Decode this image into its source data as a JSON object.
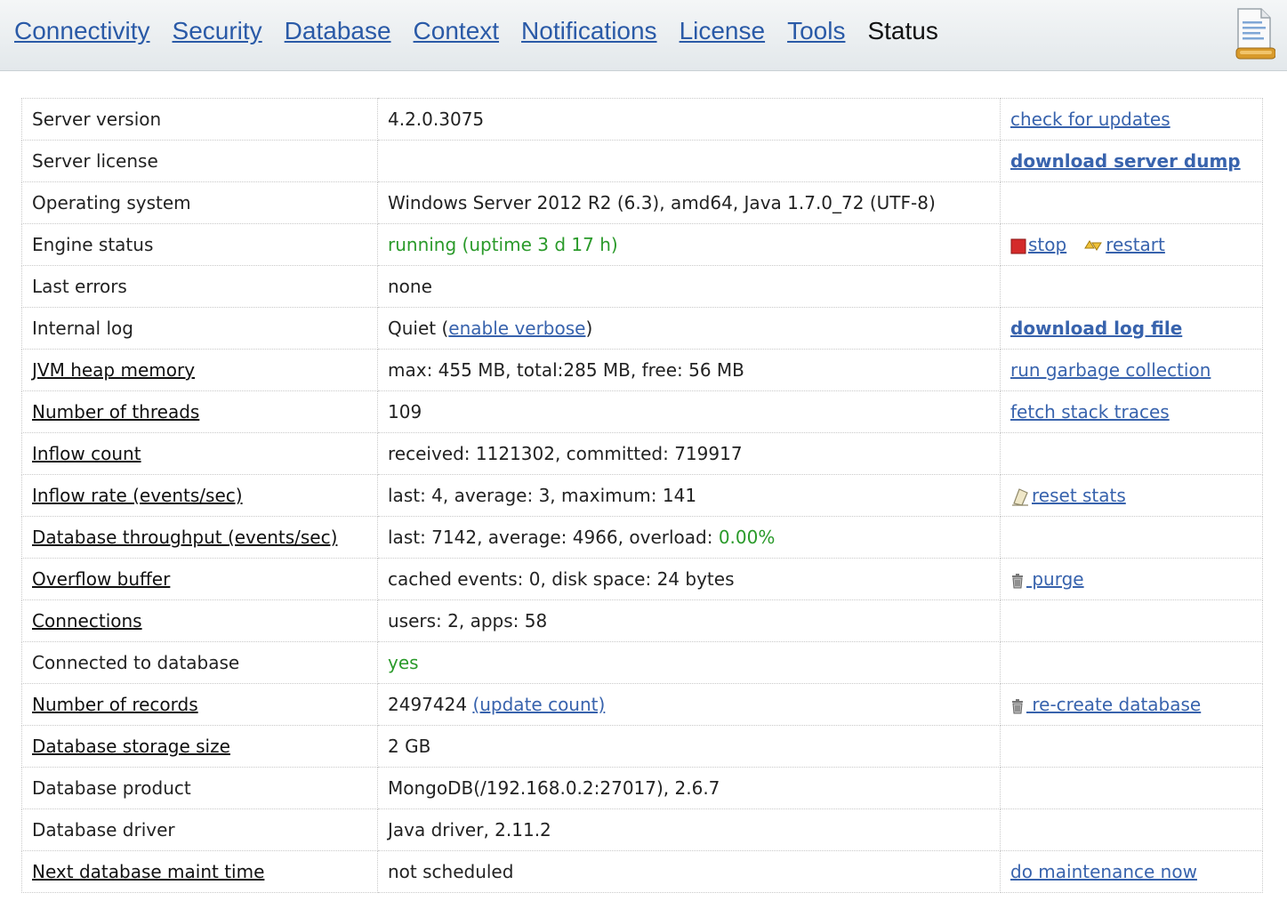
{
  "nav": {
    "tabs": [
      "Connectivity",
      "Security",
      "Database",
      "Context",
      "Notifications",
      "License",
      "Tools",
      "Status"
    ],
    "active": "Status"
  },
  "rows": {
    "server_version": {
      "label": "Server version",
      "value": "4.2.0.3075",
      "action": "check for updates"
    },
    "server_license": {
      "label": "Server license",
      "value": "",
      "action": "download server dump"
    },
    "os": {
      "label": "Operating system",
      "value": "Windows Server 2012 R2 (6.3), amd64, Java 1.7.0_72 (UTF-8)"
    },
    "engine": {
      "label": "Engine status",
      "value": "running (uptime 3 d 17 h)",
      "stop": "stop",
      "restart": "restart"
    },
    "last_errors": {
      "label": "Last errors",
      "value": "none"
    },
    "internal_log": {
      "label": "Internal log",
      "value": "Quiet",
      "open_paren": "(",
      "verbose_link": "enable verbose",
      "close_paren": ")",
      "action": "download log file"
    },
    "jvm_heap": {
      "label": "JVM heap memory",
      "value": "max: 455 MB, total:285 MB, free: 56 MB",
      "action": "run garbage collection"
    },
    "threads": {
      "label": "Number of threads",
      "value": "109",
      "action": "fetch stack traces"
    },
    "inflow_count": {
      "label": "Inflow count",
      "value": "received: 1121302, committed: 719917"
    },
    "inflow_rate": {
      "label": "Inflow rate (events/sec)",
      "value": "last: 4, average: 3, maximum: 141",
      "action": "reset stats"
    },
    "db_throughput": {
      "label": "Database throughput (events/sec)",
      "value": "last: 7142, average: 4966, overload: ",
      "overload": "0.00%"
    },
    "overflow": {
      "label": "Overflow buffer",
      "value": "cached events: 0, disk space: 24 bytes",
      "action": " purge"
    },
    "connections": {
      "label": "Connections",
      "value": "users: 2, apps: 58"
    },
    "connected_db": {
      "label": "Connected to database",
      "value": "yes"
    },
    "records": {
      "label": "Number of records",
      "value": "2497424",
      "link": "(update count)",
      "action": " re-create database"
    },
    "storage": {
      "label": "Database storage size",
      "value": "2 GB"
    },
    "product": {
      "label": "Database product",
      "value": "MongoDB(/192.168.0.2:27017), 2.6.7"
    },
    "driver": {
      "label": "Database driver",
      "value": "Java driver, 2.11.2"
    },
    "maint": {
      "label": "Next database maint time",
      "value": "not scheduled",
      "action": "do maintenance now"
    }
  },
  "icons": {
    "stop": "stop-square-icon",
    "restart": "restart-arrows-icon",
    "reset": "eraser-icon",
    "purge": "trash-icon",
    "recreate": "trash-icon",
    "document": "document-icon"
  },
  "colors": {
    "link": "#3863ad",
    "ok": "#2a9a2a",
    "stop": "#d42a2a"
  }
}
